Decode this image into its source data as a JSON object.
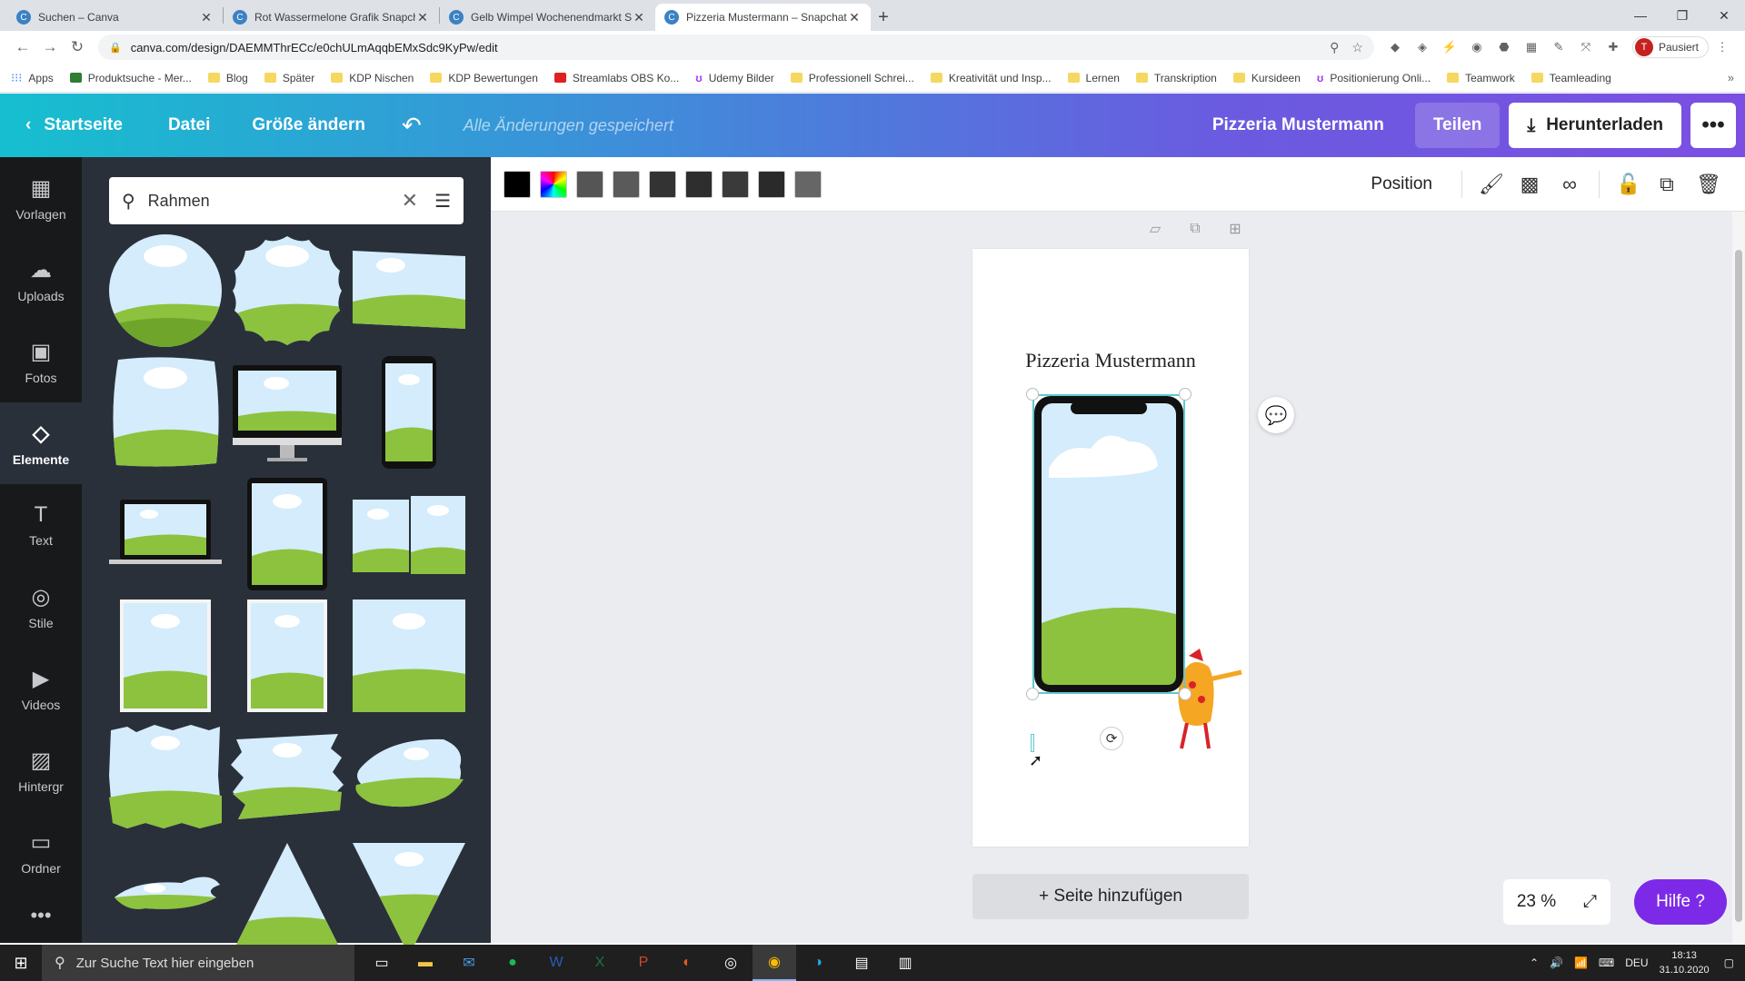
{
  "browser": {
    "tabs": [
      {
        "title": "Suchen – Canva",
        "active": false
      },
      {
        "title": "Rot Wassermelone Grafik Snapch",
        "active": false
      },
      {
        "title": "Gelb Wimpel Wochenendmarkt S",
        "active": false
      },
      {
        "title": "Pizzeria Mustermann – Snapchat",
        "active": true
      }
    ],
    "url": "canva.com/design/DAEMMThrECc/e0chULmAqqbEMxSdc9KyPw/edit",
    "profile_initial": "T",
    "profile_label": "Pausiert",
    "bookmarks": [
      {
        "label": "Apps",
        "icon": "grid"
      },
      {
        "label": "Produktsuche - Mer...",
        "icon": "green"
      },
      {
        "label": "Blog",
        "icon": "folder"
      },
      {
        "label": "Später",
        "icon": "folder"
      },
      {
        "label": "KDP Nischen",
        "icon": "folder"
      },
      {
        "label": "KDP Bewertungen",
        "icon": "folder"
      },
      {
        "label": "Streamlabs OBS Ko...",
        "icon": "red"
      },
      {
        "label": "Udemy Bilder",
        "icon": "u"
      },
      {
        "label": "Professionell Schrei...",
        "icon": "folder"
      },
      {
        "label": "Kreativität und Insp...",
        "icon": "folder"
      },
      {
        "label": "Lernen",
        "icon": "folder"
      },
      {
        "label": "Transkription",
        "icon": "folder"
      },
      {
        "label": "Kursideen",
        "icon": "folder"
      },
      {
        "label": "Positionierung Onli...",
        "icon": "u"
      },
      {
        "label": "Teamwork",
        "icon": "folder"
      },
      {
        "label": "Teamleading",
        "icon": "folder"
      }
    ]
  },
  "header": {
    "home": "Startseite",
    "file": "Datei",
    "resize": "Größe ändern",
    "saved_status": "Alle Änderungen gespeichert",
    "design_name": "Pizzeria Mustermann",
    "share": "Teilen",
    "download": "Herunterladen"
  },
  "leftnav": [
    {
      "label": "Vorlagen",
      "icon": "templates-icon",
      "glyph": "▦"
    },
    {
      "label": "Uploads",
      "icon": "upload-icon",
      "glyph": "☁"
    },
    {
      "label": "Fotos",
      "icon": "photo-icon",
      "glyph": "▣"
    },
    {
      "label": "Elemente",
      "icon": "elements-icon",
      "glyph": "◇",
      "active": true
    },
    {
      "label": "Text",
      "icon": "text-icon",
      "glyph": "T"
    },
    {
      "label": "Stile",
      "icon": "palette-icon",
      "glyph": "◎"
    },
    {
      "label": "Videos",
      "icon": "video-icon",
      "glyph": "▶"
    },
    {
      "label": "Hintergr",
      "icon": "background-icon",
      "glyph": "▨"
    },
    {
      "label": "Ordner",
      "icon": "folder-icon",
      "glyph": "▭"
    }
  ],
  "search": {
    "value": "Rahmen"
  },
  "toolbar": {
    "swatches": [
      "#000000",
      "rainbow",
      "#555555",
      "#5a5a5a",
      "#333333",
      "#2e2e2e",
      "#3a3a3a",
      "#2a2a2a",
      "#666666"
    ],
    "position": "Position"
  },
  "canvas": {
    "page_title": "Pizzeria Mustermann",
    "add_page": "+ Seite hinzufügen",
    "zoom": "23 %",
    "help": "Hilfe ?"
  },
  "taskbar": {
    "search_placeholder": "Zur Suche Text hier eingeben",
    "lang": "DEU",
    "time": "18:13",
    "date": "31.10.2020"
  },
  "colors": {
    "header_gradient_start": "#16bfcf",
    "header_gradient_end": "#7b4fe2",
    "help_button": "#7d2ae8",
    "sidepanel_bg": "#293039",
    "selection": "#5ccad3"
  }
}
